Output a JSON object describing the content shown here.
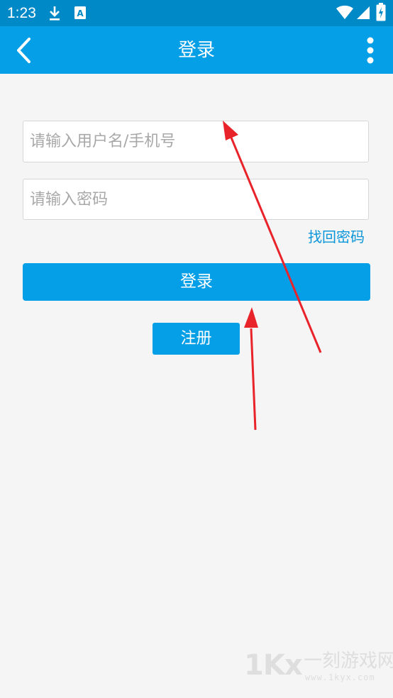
{
  "status_bar": {
    "time": "1:23",
    "icons": [
      "download-icon",
      "a-notification-icon",
      "wifi-icon",
      "signal-icon",
      "battery-icon"
    ]
  },
  "app_bar": {
    "title": "登录",
    "back_icon": "chevron-left-icon",
    "menu_icon": "more-vertical-icon"
  },
  "form": {
    "username_placeholder": "请输入用户名/手机号",
    "username_value": "",
    "password_placeholder": "请输入密码",
    "password_value": "",
    "forgot_password": "找回密码",
    "login_button": "登录",
    "register_button": "注册"
  },
  "watermark": {
    "logo": "1Kx",
    "name": "一刻游戏网",
    "url": "www.1kyx.com"
  },
  "colors": {
    "status_bar": "#0089c7",
    "primary": "#049fe6",
    "link": "#0a96d8",
    "background": "#f5f5f5",
    "annotation_arrow": "#e8232a"
  }
}
